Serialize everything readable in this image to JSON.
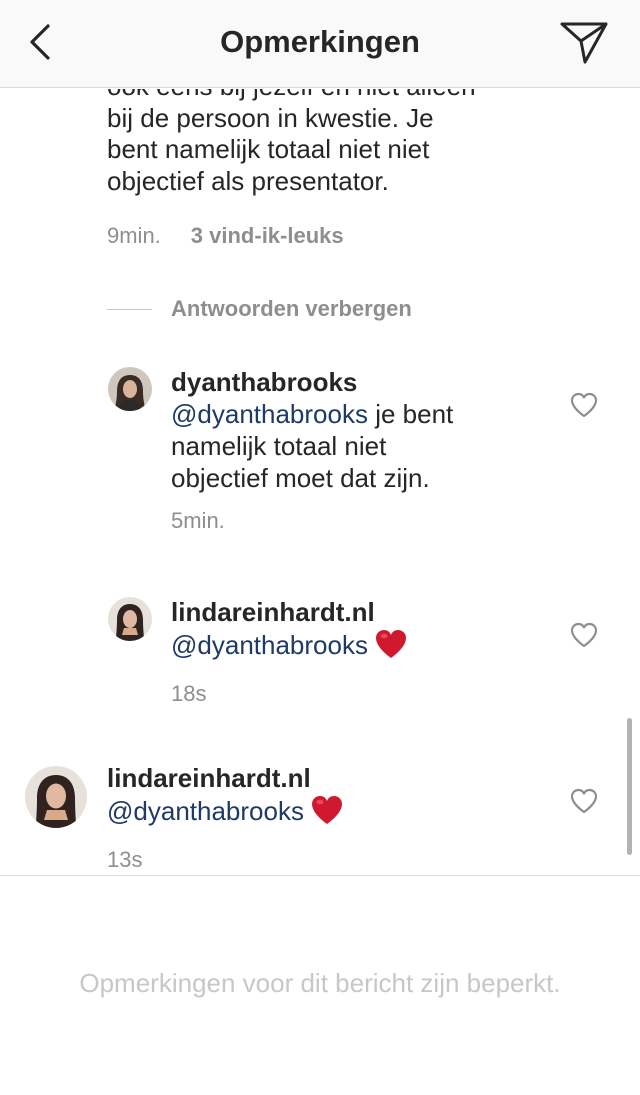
{
  "header": {
    "title": "Opmerkingen",
    "back_icon": "chevron-left-icon",
    "send_icon": "paper-plane-icon"
  },
  "parent_comment": {
    "text_lines": [
      "ook eens bij jezelf en niet alleen",
      "bij de persoon in kwestie. Je",
      "bent namelijk totaal niet niet",
      "objectief als presentator."
    ],
    "time": "9min.",
    "likes": "3 vind-ik-leuks"
  },
  "hide_replies": "Antwoorden verbergen",
  "replies": [
    {
      "username": "dyanthabrooks",
      "mention": "@dyanthabrooks",
      "text_lines": [
        " je bent",
        "namelijk totaal niet",
        "objectief moet dat zijn."
      ],
      "time": "5min."
    },
    {
      "username": "lindareinhardt.nl",
      "mention": "@dyanthabrooks",
      "emoji": "heart-emoji",
      "time": "18s"
    }
  ],
  "comment": {
    "username": "lindareinhardt.nl",
    "mention": "@dyanthabrooks",
    "emoji": "heart-emoji",
    "time": "13s"
  },
  "footer": {
    "restricted_text": "Opmerkingen voor dit bericht zijn beperkt."
  },
  "colors": {
    "text": "#262626",
    "secondary": "#8e8e8e",
    "mention": "#1e3a66",
    "heart": "#d0192f",
    "header_bg": "#f9f9f9"
  }
}
